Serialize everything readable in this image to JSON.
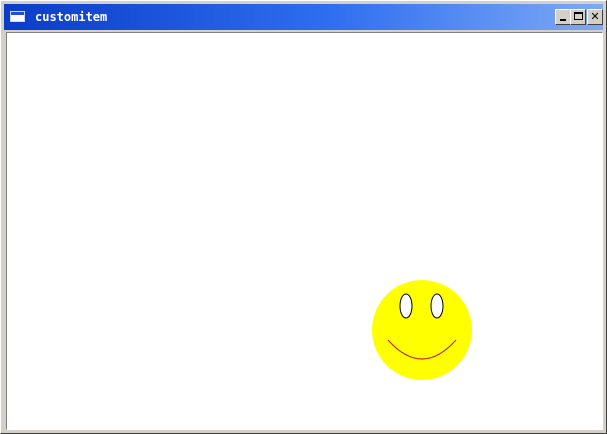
{
  "window": {
    "title": "customitem",
    "icon": "app-window-icon",
    "controls": {
      "minimize_icon": "minimize-icon",
      "maximize_icon": "maximize-icon",
      "close_icon": "close-icon",
      "close_glyph": "✕"
    }
  },
  "canvas": {
    "items": [
      {
        "type": "smiley-face",
        "face_color": "#ffff00",
        "eye_fill": "#ffffff",
        "eye_stroke": "#000000",
        "mouth_color": "#c03020"
      }
    ]
  },
  "colors": {
    "titlebar_start": "#0a3cc8",
    "titlebar_end": "#7ea9f5",
    "frame": "#d4d0c8",
    "client_bg": "#ffffff"
  }
}
